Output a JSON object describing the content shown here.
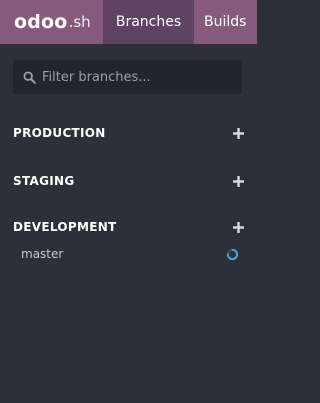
{
  "header": {
    "logo_main": "odoo",
    "logo_suffix": ".sh",
    "tabs": [
      {
        "label": "Branches",
        "active": true
      },
      {
        "label": "Builds",
        "active": false
      }
    ],
    "colors": {
      "bar": "#875a7b",
      "active_tab": "#5e4461"
    }
  },
  "search": {
    "placeholder": "Filter branches...",
    "value": ""
  },
  "sections": [
    {
      "title": "PRODUCTION",
      "branches": []
    },
    {
      "title": "STAGING",
      "branches": []
    },
    {
      "title": "DEVELOPMENT",
      "branches": [
        {
          "name": "master",
          "status_icon": "loading-spinner-icon"
        }
      ]
    }
  ],
  "icons": {
    "search": "search-icon",
    "add": "plus-icon",
    "status": "loading-spinner-icon"
  }
}
